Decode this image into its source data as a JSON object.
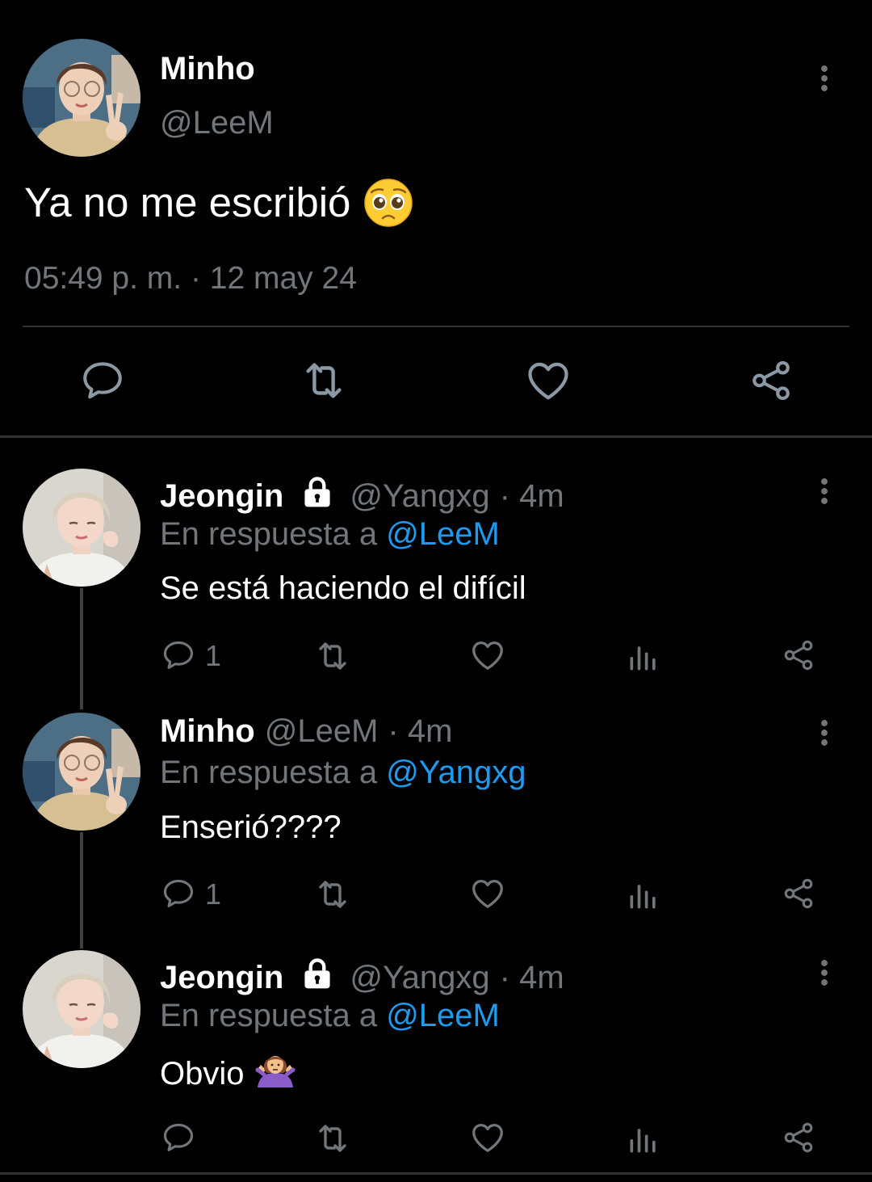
{
  "colors": {
    "background": "#000000",
    "text": "#ffffff",
    "muted": "#71767b",
    "link": "#1d9bf0",
    "divider": "#2f3336"
  },
  "main_tweet": {
    "name": "Minho",
    "handle": "@LeeM",
    "text": "Ya no me escribió",
    "emoji": "pleading-face",
    "timestamp": "05:49 p. m. · 12 may 24",
    "actions": [
      "reply-icon",
      "retweet-icon",
      "like-icon",
      "share-icon"
    ],
    "more_icon": "more-vertical-icon"
  },
  "replies": [
    {
      "name": "Jeongin",
      "protected": true,
      "handle": "@Yangxg",
      "time": "· 4m",
      "reply_prefix": "En respuesta a ",
      "reply_to": "@LeeM",
      "text": "Se está haciendo el difícil",
      "reply_count": "1"
    },
    {
      "name": "Minho",
      "protected": false,
      "handle": "@LeeM",
      "time": "· 4m",
      "reply_prefix": "En respuesta a ",
      "reply_to": "@Yangxg",
      "text": "Enserió????",
      "reply_count": "1"
    },
    {
      "name": "Jeongin",
      "protected": true,
      "handle": "@Yangxg",
      "time": "· 4m",
      "reply_prefix": "En respuesta a ",
      "reply_to": "@LeeM",
      "text": "Obvio",
      "emoji": "person-shrugging",
      "reply_count": ""
    }
  ],
  "reply_actions": [
    "reply-icon",
    "retweet-icon",
    "like-icon",
    "analytics-icon",
    "share-icon"
  ]
}
